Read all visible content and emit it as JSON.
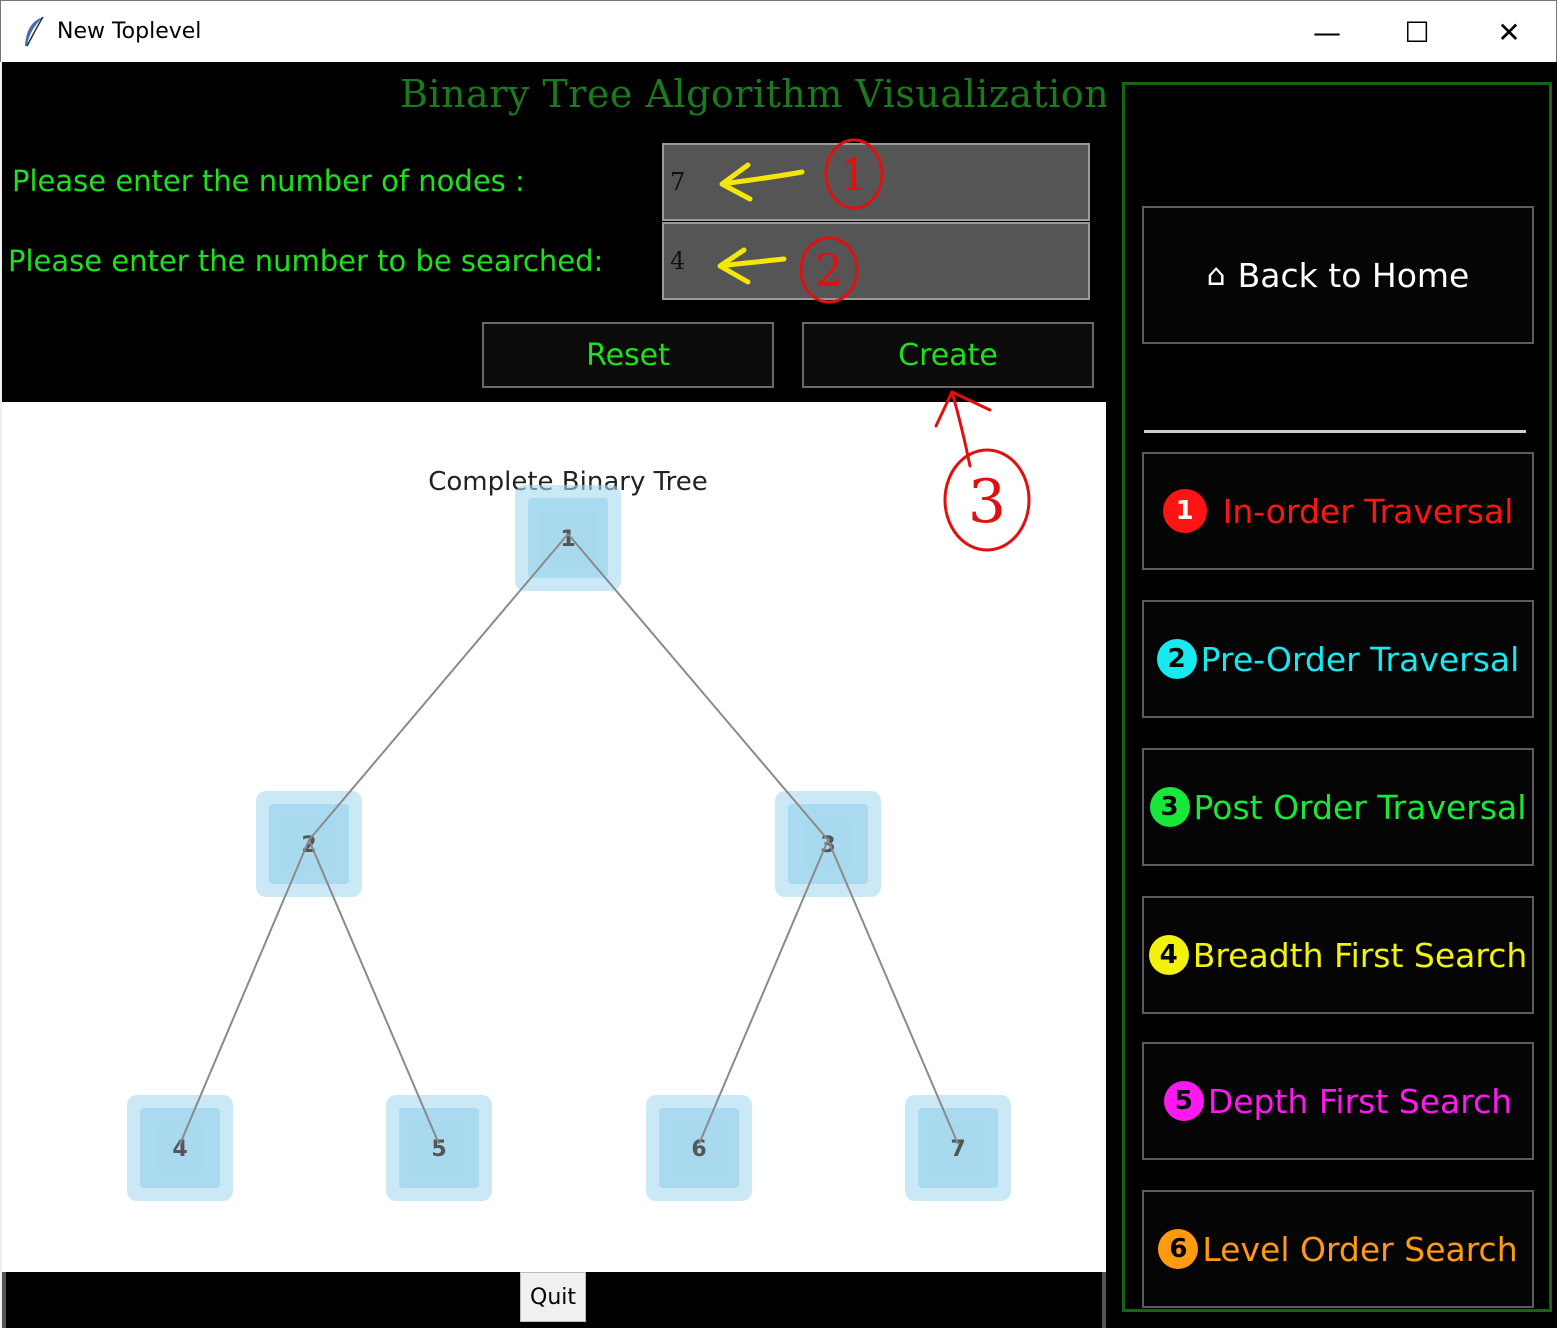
{
  "window": {
    "title": "New Toplevel",
    "minimize_glyph": "—",
    "maximize_glyph": "☐",
    "close_glyph": "✕"
  },
  "heading": "Binary Tree Algorithm Visualization",
  "form": {
    "nodes_label": "Please enter the number of nodes :",
    "nodes_value": "7",
    "search_label": "Please enter the number to be searched:",
    "search_value": "4",
    "reset_label": "Reset",
    "create_label": "Create"
  },
  "tree": {
    "title": "Complete Binary Tree",
    "nodes": [
      "1",
      "2",
      "3",
      "4",
      "5",
      "6",
      "7"
    ],
    "edges": [
      [
        "1",
        "2"
      ],
      [
        "1",
        "3"
      ],
      [
        "2",
        "4"
      ],
      [
        "2",
        "5"
      ],
      [
        "3",
        "6"
      ],
      [
        "3",
        "7"
      ]
    ]
  },
  "quit_label": "Quit",
  "sidebar": {
    "home_label": "Back to Home",
    "home_icon": "home-icon",
    "items": [
      {
        "number": "1",
        "label": "In-order Traversal",
        "color": "#ff1414"
      },
      {
        "number": "2",
        "label": "Pre-Order Traversal",
        "color": "#18e8f0"
      },
      {
        "number": "3",
        "label": "Post Order Traversal",
        "color": "#18e83a"
      },
      {
        "number": "4",
        "label": "Breadth First Search",
        "color": "#f2f20c"
      },
      {
        "number": "5",
        "label": "Depth First Search",
        "color": "#ff18f0"
      },
      {
        "number": "6",
        "label": "Level Order Search",
        "color": "#ff9a10"
      }
    ]
  },
  "annotations": [
    "1",
    "2",
    "3"
  ],
  "colors": {
    "heading": "#1b7a1b",
    "prompt": "#1ee01e",
    "node_fill": "#a6d8ee",
    "edge": "#8a8a8a",
    "annotation_arrow": "#f5e60a",
    "annotation_number": "#e01010"
  }
}
